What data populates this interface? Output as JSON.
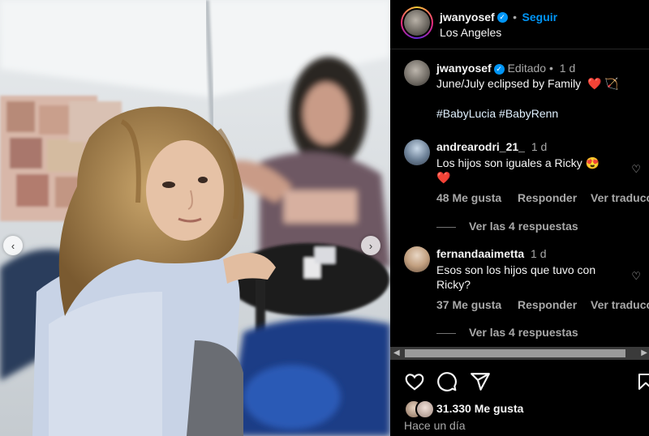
{
  "post": {
    "username": "jwanyosef",
    "separator": "•",
    "follow_label": "Seguir",
    "location": "Los Angeles"
  },
  "caption": {
    "username": "jwanyosef",
    "edited": "Editado",
    "dot": "•",
    "time": "1 d",
    "text": "June/July eclipsed by Family",
    "emojis": "❤️ 🏹",
    "hashtags": "#BabyLucia #BabyRenn"
  },
  "comments": [
    {
      "username": "andrearodri_21_",
      "time": "1 d",
      "text_line1": "Los hijos son iguales a Ricky 😍",
      "text_line2": "❤️",
      "likes": "48 Me gusta",
      "reply": "Responder",
      "translate": "Ver traducción",
      "replies": "Ver las 4 respuestas"
    },
    {
      "username": "fernandaaimetta",
      "time": "1 d",
      "text_line1": "Esos son los hijos que tuvo con",
      "text_line2": "Ricky?",
      "likes": "37 Me gusta",
      "reply": "Responder",
      "translate": "Ver traducción",
      "replies": "Ver las 4 respuestas"
    }
  ],
  "footer": {
    "likes_count": "31.330 Me gusta",
    "posted": "Hace un día"
  },
  "icons": {
    "like": "heart-icon",
    "comment": "comment-icon",
    "share": "share-icon",
    "save": "bookmark-icon"
  },
  "colors": {
    "accent": "#0095f6",
    "heart": "#ff3040",
    "muted": "#a8a8a8"
  }
}
